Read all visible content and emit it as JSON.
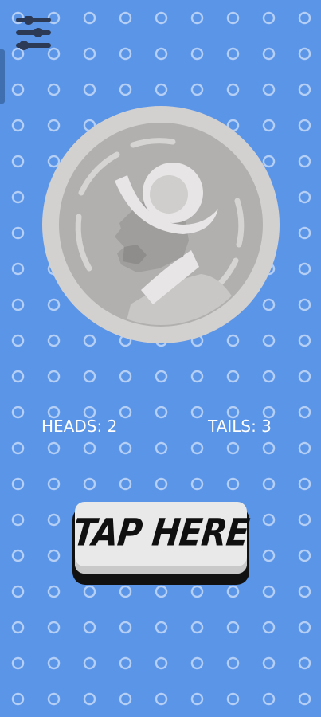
{
  "app": {
    "background_color": "#5b95e8",
    "accent_color": "#ffffff"
  },
  "toolbar": {
    "settings_icon": "sliders-icon"
  },
  "coin": {
    "face": "heads",
    "icon": "coin-profile-portrait-icon",
    "colors": {
      "rim": "#d3d0d0",
      "face": "#b2afaf",
      "detail": "#e7e5e5"
    }
  },
  "score": {
    "heads_text": "HEADS: 2",
    "tails_text": "TAILS: 3",
    "heads": 2,
    "tails": 3
  },
  "action": {
    "tap_label": "TAP HERE"
  }
}
